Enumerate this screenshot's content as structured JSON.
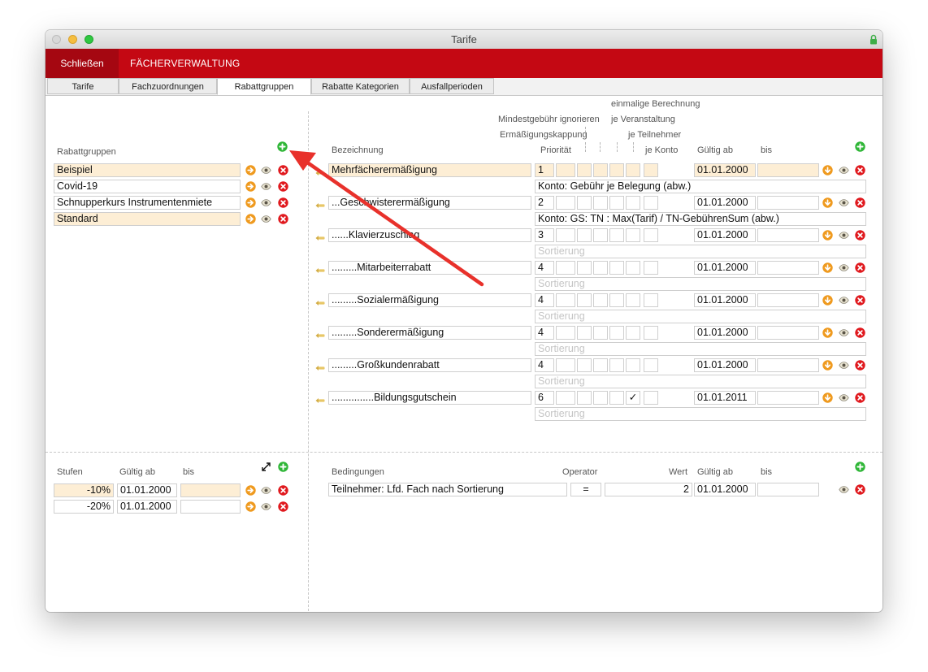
{
  "window": {
    "title": "Tarife"
  },
  "toolbar": {
    "close_label": "Schließen",
    "section_label": "FÄCHERVERWALTUNG"
  },
  "tabs": [
    {
      "label": "Tarife"
    },
    {
      "label": "Fachzuordnungen"
    },
    {
      "label": "Rabattgruppen"
    },
    {
      "label": "Rabatte Kategorien"
    },
    {
      "label": "Ausfallperioden"
    }
  ],
  "rabattgruppen": {
    "header": "Rabattgruppen",
    "items": [
      "Beispiel",
      "Covid-19",
      "Schnupperkurs Instrumentenmiete",
      "Standard"
    ]
  },
  "rabatte": {
    "headers": {
      "bezeichnung": "Bezeichnung",
      "prioritaet": "Priorität",
      "ermaessigungskappung": "Ermäßigungskappung",
      "mindestgebuehr": "Mindestgebühr ignorieren",
      "einmalige": "einmalige Berechnung",
      "je_veranstaltung": "je Veranstaltung",
      "je_teilnehmer": "je Teilnehmer",
      "je_konto": "je Konto",
      "gueltig_ab": "Gültig ab",
      "bis": "bis"
    },
    "rows": [
      {
        "name": "Mehrfächerermäßigung",
        "prio": "1",
        "check": "",
        "date": "01.01.2000",
        "sub": "Konto: Gebühr je Belegung (abw.)"
      },
      {
        "name": "...Geschwisterermäßigung",
        "prio": "2",
        "check": "",
        "date": "01.01.2000",
        "sub": "Konto: GS: TN : Max(Tarif) / TN-GebührenSum (abw.)"
      },
      {
        "name": "......Klavierzuschlag",
        "prio": "3",
        "check": "",
        "date": "01.01.2000",
        "sub": ""
      },
      {
        "name": ".........Mitarbeiterrabatt",
        "prio": "4",
        "check": "",
        "date": "01.01.2000",
        "sub": ""
      },
      {
        "name": ".........Sozialermäßigung",
        "prio": "4",
        "check": "",
        "date": "01.01.2000",
        "sub": ""
      },
      {
        "name": ".........Sonderermäßigung",
        "prio": "4",
        "check": "",
        "date": "01.01.2000",
        "sub": ""
      },
      {
        "name": ".........Großkundenrabatt",
        "prio": "4",
        "check": "",
        "date": "01.01.2000",
        "sub": ""
      },
      {
        "name": "...............Bildungsgutschein",
        "prio": "6",
        "check": "✓",
        "date": "01.01.2011",
        "sub": ""
      }
    ],
    "sort_placeholder": "Sortierung"
  },
  "stufen": {
    "headers": {
      "stufen": "Stufen",
      "gueltig_ab": "Gültig ab",
      "bis": "bis"
    },
    "rows": [
      {
        "value": "-10%",
        "date": "01.01.2000"
      },
      {
        "value": "-20%",
        "date": "01.01.2000"
      }
    ]
  },
  "bedingungen": {
    "headers": {
      "bedingungen": "Bedingungen",
      "operator": "Operator",
      "wert": "Wert",
      "gueltig_ab": "Gültig ab",
      "bis": "bis"
    },
    "rows": [
      {
        "name": "Teilnehmer: Lfd. Fach nach Sortierung",
        "operator": "=",
        "wert": "2",
        "date": "01.01.2000"
      }
    ]
  },
  "colors": {
    "accent_red": "#c40813",
    "close_red": "#a50711",
    "add_green": "#2fb637",
    "go_orange": "#ef9a1f",
    "delete_red": "#e0191e",
    "selected_row": "#fdeed5"
  }
}
